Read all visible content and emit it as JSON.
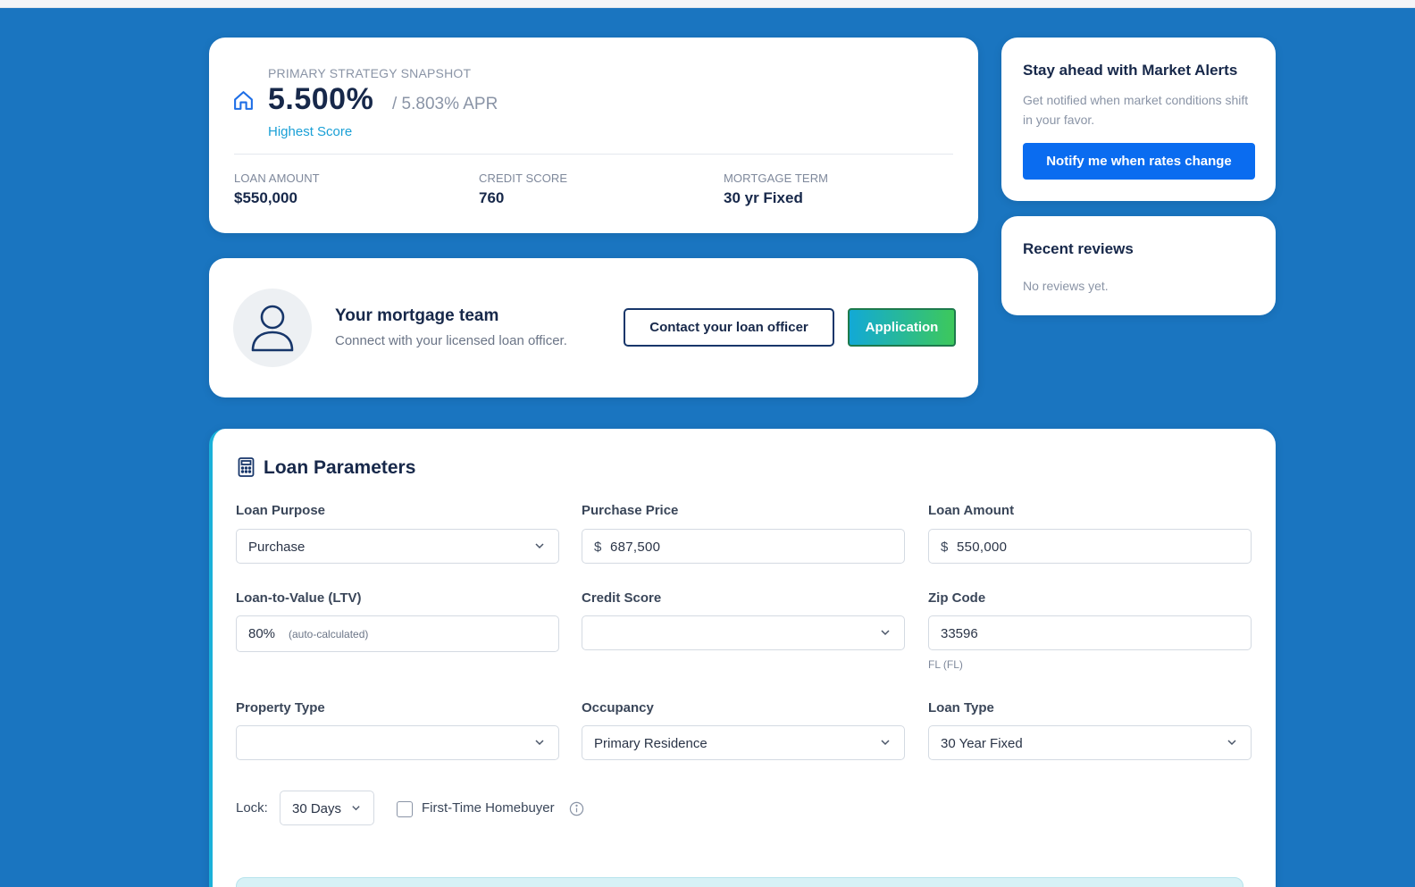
{
  "snapshot": {
    "label": "PRIMARY STRATEGY SNAPSHOT",
    "rate": "5.500%",
    "apr": "/ 5.803% APR",
    "score_label": "Highest Score",
    "stats": [
      {
        "key": "LOAN AMOUNT",
        "value": "$550,000"
      },
      {
        "key": "CREDIT SCORE",
        "value": "760"
      },
      {
        "key": "MORTGAGE TERM",
        "value": "30 yr Fixed"
      }
    ]
  },
  "alerts": {
    "title": "Stay ahead with Market Alerts",
    "description": "Get notified when market conditions shift in your favor.",
    "button": "Notify me when rates change"
  },
  "reviews": {
    "title": "Recent reviews",
    "empty": "No reviews yet."
  },
  "team": {
    "title": "Your mortgage team",
    "subtitle": "Connect with your licensed loan officer.",
    "contact_button": "Contact your loan officer",
    "application_button": "Application"
  },
  "params": {
    "title": "Loan Parameters",
    "fields": {
      "loan_purpose": {
        "label": "Loan Purpose",
        "value": "Purchase"
      },
      "purchase_price": {
        "label": "Purchase Price",
        "prefix": "$",
        "value": "687,500"
      },
      "loan_amount": {
        "label": "Loan Amount",
        "prefix": "$",
        "value": "550,000"
      },
      "ltv": {
        "label": "Loan-to-Value (LTV)",
        "value": "80%",
        "hint": "(auto-calculated)"
      },
      "credit_score": {
        "label": "Credit Score",
        "value": ""
      },
      "zip_code": {
        "label": "Zip Code",
        "value": "33596",
        "subhint": "FL (FL)"
      },
      "property_type": {
        "label": "Property Type",
        "value": ""
      },
      "occupancy": {
        "label": "Occupancy",
        "value": "Primary Residence"
      },
      "loan_type": {
        "label": "Loan Type",
        "value": "30 Year Fixed"
      }
    },
    "lock": {
      "label": "Lock:",
      "value": "30 Days"
    },
    "first_time": {
      "label": "First-Time Homebuyer",
      "checked": false
    }
  },
  "colors": {
    "background": "#1a75c0",
    "primary_button": "#0a6cf0",
    "accent_teal": "#1aa0d6",
    "gradient_start": "#12a9d6",
    "gradient_end": "#3dc85b",
    "heading": "#17284a"
  },
  "icons": [
    "home-icon",
    "user-icon",
    "calculator-icon",
    "chevron-down-icon",
    "info-icon"
  ]
}
